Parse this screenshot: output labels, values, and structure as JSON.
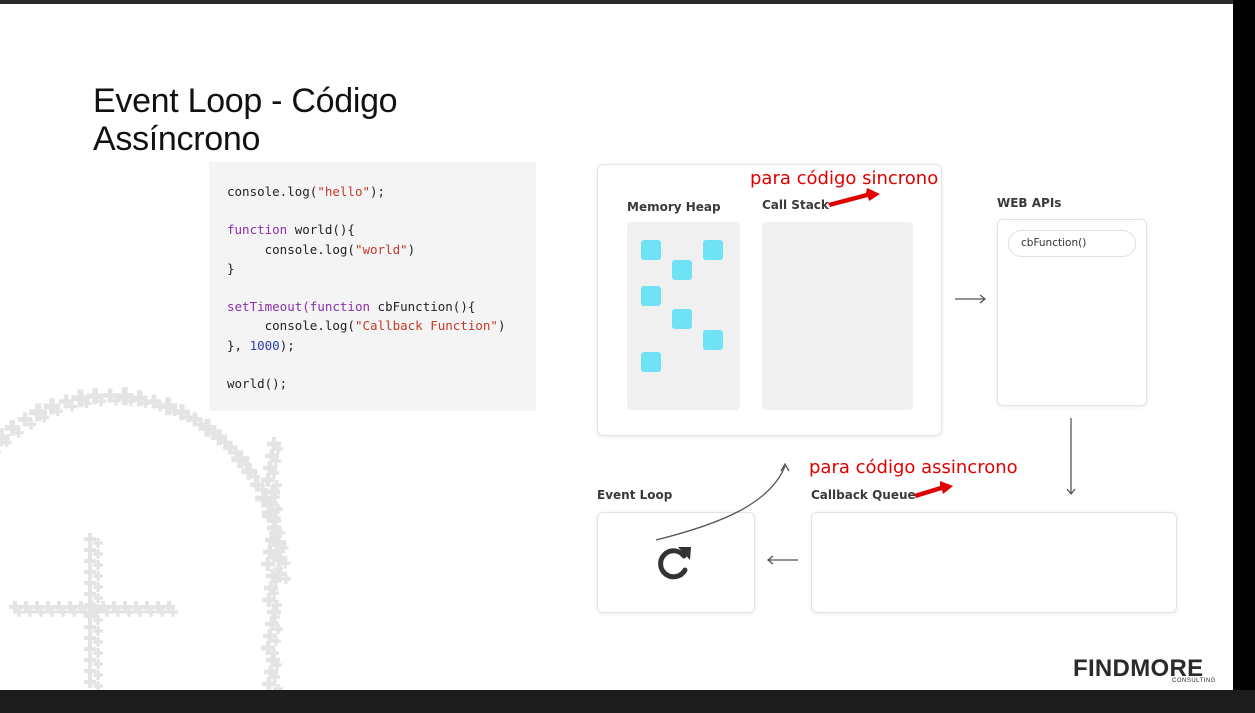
{
  "slide": {
    "title_line1": "Event Loop - Código",
    "title_line2": "Assíncrono"
  },
  "code": {
    "lines": [
      [
        {
          "t": "console.log("
        },
        {
          "t": "\"hello\"",
          "c": "str"
        },
        {
          "t": ");"
        }
      ],
      [],
      [
        {
          "t": "function",
          "c": "kw"
        },
        {
          "t": " world(){"
        }
      ],
      [
        {
          "t": "     console.log("
        },
        {
          "t": "\"world\"",
          "c": "str"
        },
        {
          "t": ")"
        }
      ],
      [
        {
          "t": "}"
        }
      ],
      [],
      [
        {
          "t": "setTimeout(",
          "c": "kw"
        },
        {
          "t": "function",
          "c": "kw"
        },
        {
          "t": " cbFunction(){"
        }
      ],
      [
        {
          "t": "     console.log("
        },
        {
          "t": "\"Callback Function\"",
          "c": "str"
        },
        {
          "t": ")"
        }
      ],
      [
        {
          "t": "}, "
        },
        {
          "t": "1000",
          "c": "num"
        },
        {
          "t": ");"
        }
      ],
      [],
      [
        {
          "t": "world();"
        }
      ]
    ]
  },
  "diagram": {
    "memory_heap_label": "Memory Heap",
    "call_stack_label": "Call Stack",
    "web_apis_label": "WEB APIs",
    "web_api_item": "cbFunction()",
    "event_loop_label": "Event Loop",
    "callback_queue_label": "Callback Queue",
    "arrow_right": "⟶",
    "arrow_left": "⟵"
  },
  "annotations": {
    "sync": "para código sincrono",
    "async": "para código assincrono"
  },
  "logo": {
    "name": "FINDMORE",
    "sub": "CONSULTING"
  },
  "colors": {
    "annotation": "#e00000",
    "heap_square": "#6fe3f5",
    "keyword": "#8a2fa8",
    "string": "#c0392b",
    "number": "#2c3ea8"
  }
}
